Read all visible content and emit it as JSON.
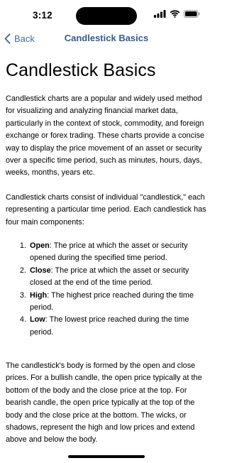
{
  "status_bar": {
    "time": "3:12"
  },
  "nav": {
    "back_label": "Back",
    "title": "Candlestick Basics",
    "accent_color": "#4a6d97"
  },
  "page": {
    "title": "Candlestick Basics",
    "intro": "Candlestick charts are a popular and widely used method for visualizing and analyzing financial market data, particularly in the context of stock, commodity, and foreign exchange or forex trading. These charts provide a concise way to display the price movement of an asset or security over a specific time period, such as minutes, hours, days, weeks, months, years etc.",
    "components_intro": "Candlestick charts consist of individual \"candlestick,\" each representing a particular time period. Each candlestick has four main components:",
    "components": [
      {
        "term": "Open",
        "description": ": The price at which the asset or security opened during the specified time period."
      },
      {
        "term": "Close",
        "description": ": The price at which the asset or security closed at the end of the time period."
      },
      {
        "term": "High",
        "description": ": The highest price reached during the time period."
      },
      {
        "term": "Low",
        "description": ": The lowest price reached during the time period."
      }
    ],
    "body_explanation": "The candlestick's body is formed by the open and close prices. For a bullish candle, the open price typically at the bottom of the body and the close price at the top. For bearish candle, the open price typically at the top of the body and the close price at the bottom. The wicks, or shadows, represent the high and low prices and extend above and below the body."
  },
  "icons": {
    "signal": "cellular-signal-icon",
    "wifi": "wifi-icon",
    "battery": "battery-icon",
    "back": "chevron-left-icon"
  }
}
